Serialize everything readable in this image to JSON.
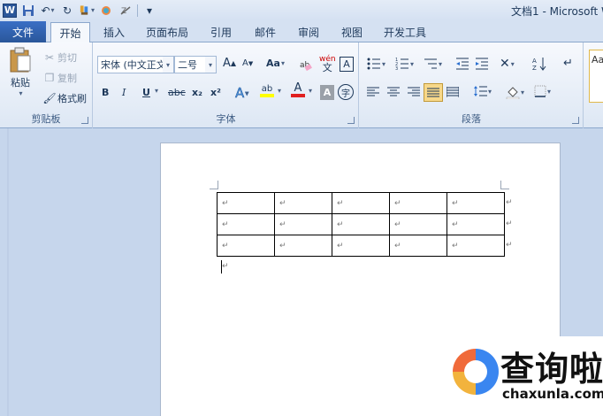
{
  "window": {
    "title": "文档1 - Microsoft W"
  },
  "tabs": {
    "file": "文件",
    "items": [
      "开始",
      "插入",
      "页面布局",
      "引用",
      "邮件",
      "审阅",
      "视图",
      "开发工具"
    ]
  },
  "clipboard": {
    "paste": "粘贴",
    "cut": "剪切",
    "copy": "复制",
    "format_painter": "格式刷",
    "label": "剪贴板"
  },
  "font": {
    "name": "宋体 (中文正文)",
    "size": "二号",
    "bold": "B",
    "italic": "I",
    "underline": "U",
    "strike": "abc",
    "subscript": "x₂",
    "superscript": "x²",
    "grow": "A",
    "shrink": "A",
    "change_case": "Aa",
    "pinyin": "wén",
    "char_border": "A",
    "text_effect": "A",
    "highlight": "ab",
    "font_color": "A",
    "char_shading": "A",
    "enclose": "字",
    "label": "字体"
  },
  "paragraph": {
    "label": "段落"
  },
  "styles": {
    "preview": "Aa"
  },
  "document": {
    "rows": 3,
    "cols": 5,
    "cell_mark": "↵"
  },
  "watermark": {
    "name": "查询啦",
    "url": "chaxunla.com"
  },
  "colors": {
    "file_tab": "#2a579a",
    "highlight_active": "#f7d88a",
    "font_red": "#e02020",
    "highlight_yellow": "#ffff00"
  }
}
